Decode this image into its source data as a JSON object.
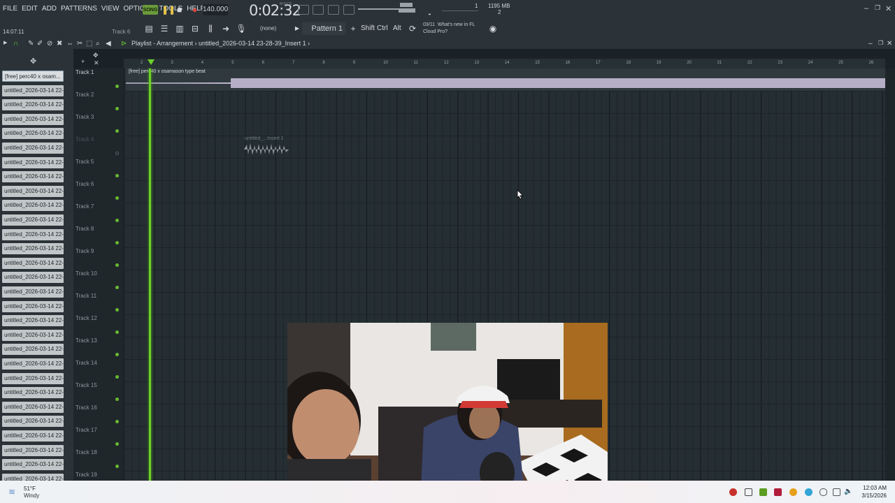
{
  "menu": [
    "FILE",
    "EDIT",
    "ADD",
    "PATTERNS",
    "VIEW",
    "OPTIONS",
    "TOOLS",
    "HELP"
  ],
  "transport": {
    "mode": "SONG",
    "tempo": "140.000",
    "time": "0:02:32",
    "time_unit": "M:S:CS"
  },
  "status": {
    "cpu": "1",
    "memory": "1195 MB",
    "polyphony": "2"
  },
  "toolbar2": {
    "clock": "14:07:11",
    "hint_track": "Track 6",
    "snap": "(none)",
    "pattern": "Pattern 1",
    "keys": [
      "Shift",
      "Ctrl",
      "Alt"
    ],
    "news_date": "03/11",
    "news_line1": "What's new in FL",
    "news_line2": "Cloud Pro?"
  },
  "playlist": {
    "title": "Playlist - Arrangement",
    "breadcrumb": "untitled_2026-03-14 23-28-39_Insert 1"
  },
  "browser_clips": [
    "[free] perc40 x osam...",
    "untitled_2026-03-14 22-...",
    "untitled_2026-03-14 22-...",
    "untitled_2026-03-14 22-...",
    "untitled_2026-03-14 22-...",
    "untitled_2026-03-14 22-...",
    "untitled_2026-03-14 22-...",
    "untitled_2026-03-14 22-...",
    "untitled_2026-03-14 22-...",
    "untitled_2026-03-14 22-...",
    "untitled_2026-03-14 22-...",
    "untitled_2026-03-14 22-...",
    "untitled_2026-03-14 22-...",
    "untitled_2026-03-14 22-...",
    "untitled_2026-03-14 22-...",
    "untitled_2026-03-14 22-...",
    "untitled_2026-03-14 22-...",
    "untitled_2026-03-14 22-...",
    "untitled_2026-03-14 22-...",
    "untitled_2026-03-14 22-...",
    "untitled_2026-03-14 22-...",
    "untitled_2026-03-14 22-...",
    "untitled_2026-03-14 22-...",
    "untitled_2026-03-14 22-...",
    "untitled_2026-03-14 22-...",
    "untitled_2026-03-14 22-...",
    "untitled_2026-03-14 22-...",
    "untitled_2026-03-14 22-...",
    "untitled_2026-03-14 22-...",
    "untitled_2026-03-14 22-..."
  ],
  "tracks": [
    "Track 1",
    "Track 2",
    "Track 3",
    "Track 4",
    "Track 5",
    "Track 6",
    "Track 7",
    "Track 8",
    "Track 9",
    "Track 10",
    "Track 11",
    "Track 12",
    "Track 13",
    "Track 14",
    "Track 15",
    "Track 16",
    "Track 17",
    "Track 18",
    "Track 19"
  ],
  "ruler": [
    "2",
    "3",
    "4",
    "5",
    "6",
    "7",
    "8",
    "9",
    "10",
    "11",
    "12",
    "13",
    "14",
    "15",
    "16",
    "17",
    "18",
    "19",
    "20",
    "21",
    "22",
    "23",
    "24",
    "25",
    "26"
  ],
  "clips": {
    "main_audio": "[free] perc40 x osamason type beat",
    "muted_audio": "untitled_...Insert 1"
  },
  "taskbar": {
    "temp": "51°F",
    "weather": "Windy",
    "time": "12:03 AM",
    "date": "3/15/2026"
  },
  "colors": {
    "accent": "#6ed02a",
    "bg": "#1b2227",
    "panel": "#2b3338"
  }
}
